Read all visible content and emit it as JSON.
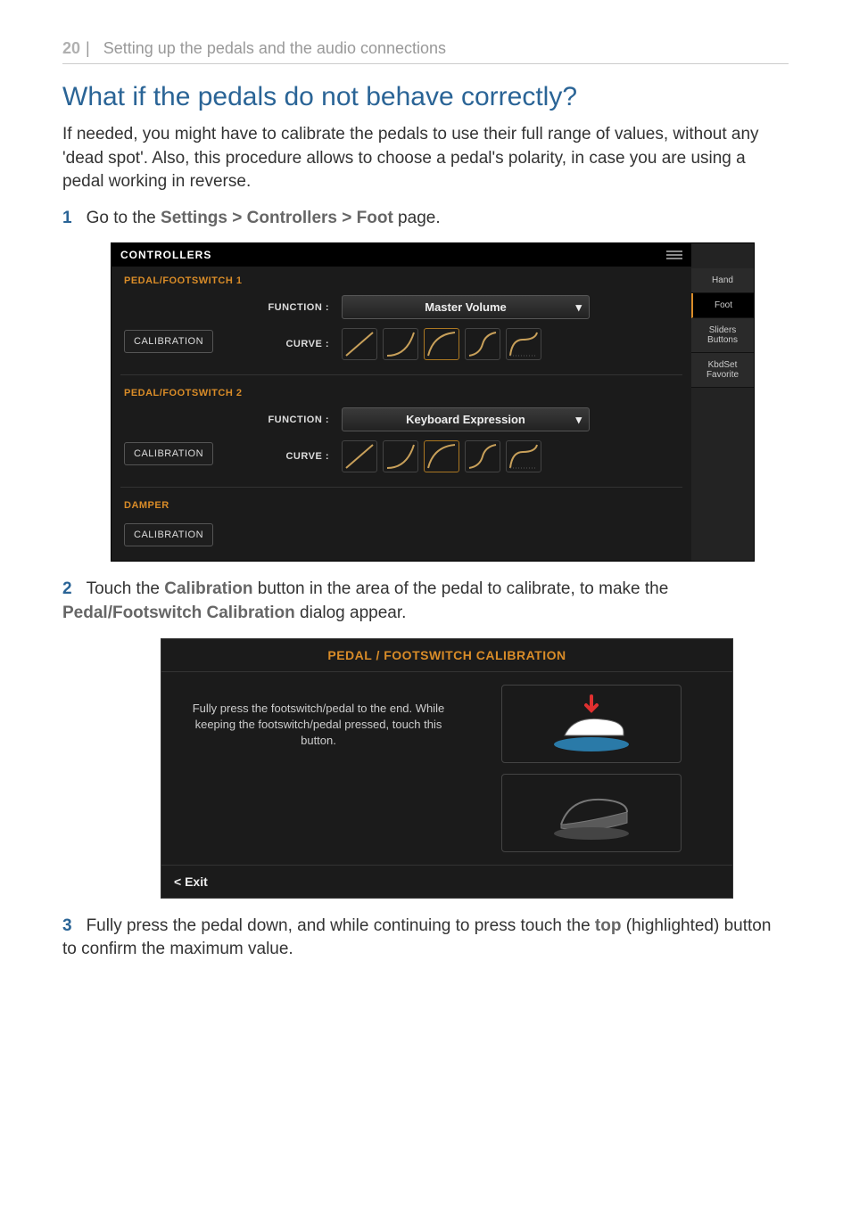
{
  "header": {
    "page": "20",
    "divider": "|",
    "section": "Setting up the pedals and the audio connections"
  },
  "h2": "What if the pedals do not behave correctly?",
  "p1": "If needed, you might have to calibrate the pedals to use their full range of values, without any 'dead spot'. Also, this procedure allows to choose a pedal's polarity, in case you are using a pedal working in reverse.",
  "step1": {
    "num": "1",
    "pre": "Go to the ",
    "path": "Settings > Controllers > Foot",
    "post": " page."
  },
  "controllers": {
    "title": "CONTROLLERS",
    "section1": "PEDAL/FOOTSWITCH 1",
    "calibration": "CALIBRATION",
    "functionLabel": "FUNCTION :",
    "curveLabel": "CURVE :",
    "func1": "Master Volume",
    "section2": "PEDAL/FOOTSWITCH 2",
    "func2": "Keyboard Expression",
    "section3": "DAMPER",
    "side": {
      "hand": "Hand",
      "foot": "Foot",
      "sliders": "Sliders\nButtons",
      "kbdset": "KbdSet\nFavorite"
    }
  },
  "step2": {
    "num": "2",
    "pre": "Touch the ",
    "t1": "Calibration",
    "mid": " button in the area of the pedal to calibrate, to make the ",
    "t2": "Pedal/Footswitch Calibration",
    "post": " dialog appear."
  },
  "dialog": {
    "title": "PEDAL / FOOTSWITCH CALIBRATION",
    "text": "Fully press the footswitch/pedal to the end. While keeping the footswitch/pedal pressed, touch this button.",
    "exit": "< Exit"
  },
  "step3": {
    "num": "3",
    "pre": "Fully press the pedal down, and while continuing to press touch the ",
    "t1": "top",
    "post": " (highlighted) button to confirm the maximum value."
  }
}
